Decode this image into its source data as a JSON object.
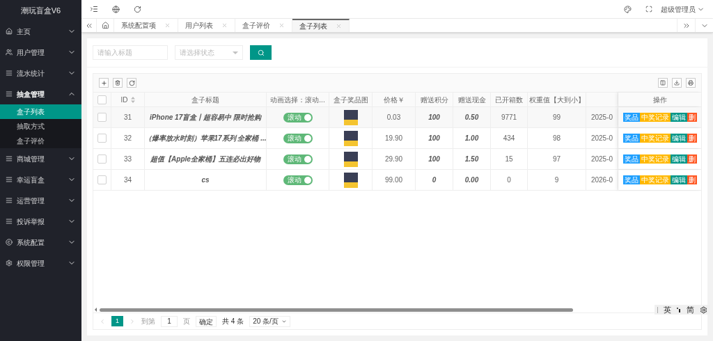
{
  "sidebar": {
    "logo": "潮玩盲盒V6",
    "items": [
      {
        "label": "主页",
        "expanded": false
      },
      {
        "label": "用户管理",
        "expanded": false
      },
      {
        "label": "流水统计",
        "expanded": false
      },
      {
        "label": "抽盒管理",
        "expanded": true,
        "children": [
          {
            "label": "盒子列表",
            "selected": true
          },
          {
            "label": "抽取方式",
            "selected": false
          },
          {
            "label": "盒子评价",
            "selected": false
          }
        ]
      },
      {
        "label": "商城管理",
        "expanded": false
      },
      {
        "label": "幸运盲盒",
        "expanded": false
      },
      {
        "label": "运营管理",
        "expanded": false
      },
      {
        "label": "投诉举报",
        "expanded": false
      },
      {
        "label": "系统配置",
        "expanded": false
      },
      {
        "label": "权限管理",
        "expanded": false
      }
    ]
  },
  "header": {
    "user": "超级管理员"
  },
  "tabs": [
    {
      "label": "系统配置项",
      "selected": false
    },
    {
      "label": "用户列表",
      "selected": false
    },
    {
      "label": "盒子评价",
      "selected": false
    },
    {
      "label": "盒子列表",
      "selected": true
    }
  ],
  "search": {
    "title_placeholder": "请输入标题",
    "status_placeholder": "请选择状态"
  },
  "table": {
    "columns": [
      "ID",
      "盒子标题",
      "动画选择：滚动...",
      "盒子奖品图",
      "价格￥",
      "赠送积分",
      "赠送现金",
      "已开箱数",
      "权重值【大到小】",
      "操作"
    ],
    "header_checked": false,
    "rows": [
      {
        "checked": false,
        "id": "31",
        "title": "iPhone 17盲盒丨超容易中 限时抢购",
        "animation": {
          "label": "滚动",
          "on": true
        },
        "price": "0.03",
        "points": "100",
        "cash": "0.50",
        "opened": "9771",
        "weight": "99",
        "date": "2025-0",
        "actions": [
          {
            "label": "奖品",
            "color": "#1e9fff"
          },
          {
            "label": "中奖记录",
            "color": "#ffb800"
          },
          {
            "label": "编辑",
            "color": "#009688"
          },
          {
            "label": "删",
            "color": "#ff5722"
          }
        ]
      },
      {
        "checked": false,
        "id": "32",
        "title": "（爆率放水时刻）苹果17系列 全家桶 ...",
        "animation": {
          "label": "滚动",
          "on": true
        },
        "price": "19.90",
        "points": "100",
        "cash": "1.00",
        "opened": "434",
        "weight": "98",
        "date": "2025-0",
        "actions": [
          {
            "label": "奖品",
            "color": "#1e9fff"
          },
          {
            "label": "中奖记录",
            "color": "#ffb800"
          },
          {
            "label": "编辑",
            "color": "#009688"
          },
          {
            "label": "删",
            "color": "#ff5722"
          }
        ]
      },
      {
        "checked": false,
        "id": "33",
        "title": "超值【Apple全家桶】五连必出好物",
        "animation": {
          "label": "滚动",
          "on": true
        },
        "price": "29.90",
        "points": "100",
        "cash": "1.50",
        "opened": "15",
        "weight": "97",
        "date": "2025-0",
        "actions": [
          {
            "label": "奖品",
            "color": "#1e9fff"
          },
          {
            "label": "中奖记录",
            "color": "#ffb800"
          },
          {
            "label": "编辑",
            "color": "#009688"
          },
          {
            "label": "删",
            "color": "#ff5722"
          }
        ]
      },
      {
        "checked": false,
        "id": "34",
        "title": "cs",
        "animation": {
          "label": "滚动",
          "on": true
        },
        "price": "99.00",
        "points": "0",
        "cash": "0.00",
        "opened": "0",
        "weight": "9",
        "date": "2026-0",
        "actions": [
          {
            "label": "奖品",
            "color": "#1e9fff"
          },
          {
            "label": "中奖记录",
            "color": "#ffb800"
          },
          {
            "label": "编辑",
            "color": "#009688"
          },
          {
            "label": "删",
            "color": "#ff5722"
          }
        ]
      }
    ]
  },
  "pagination": {
    "pages": [
      {
        "label": "1",
        "selected": true
      }
    ],
    "goto_label": "到第",
    "goto_value": "1",
    "page_unit": "页",
    "confirm": "确定",
    "total": "共 4 条",
    "page_size": "20 条/页"
  },
  "ime": {
    "lang": "英",
    "mode": "简"
  }
}
